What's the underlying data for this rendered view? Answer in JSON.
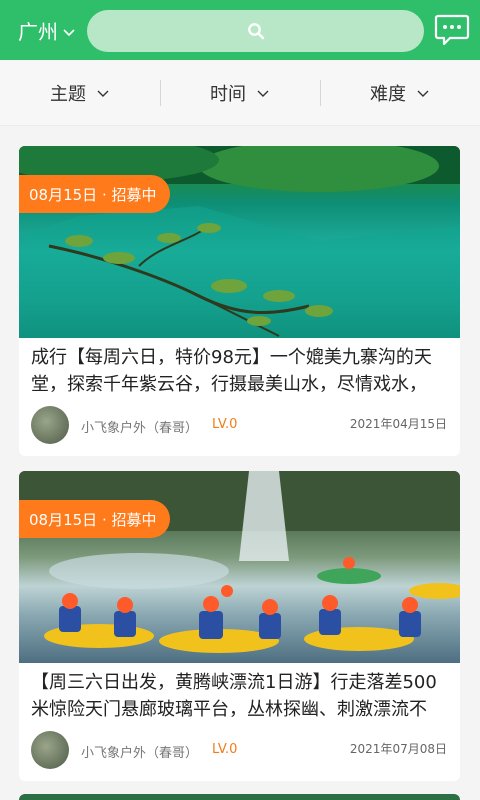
{
  "header": {
    "city": "广州",
    "search_placeholder": "",
    "icons": {
      "city_dropdown": "chevron-down-icon",
      "search": "search-icon",
      "message": "chat-bubble-icon"
    },
    "brand_color": "#2fbf6b"
  },
  "filters": [
    {
      "label": "主题"
    },
    {
      "label": "时间"
    },
    {
      "label": "难度"
    }
  ],
  "cards": [
    {
      "badge": "08月15日 · 招募中",
      "title": "成行【每周六日，特价98元】一个媲美九寨沟的天堂，探索千年紫云谷，行摄最美山水，尽情戏水，",
      "author": "小飞象户外（春哥）",
      "level": "LV.0",
      "date": "2021年04月15日"
    },
    {
      "badge": "08月15日 · 招募中",
      "title": "【周三六日出发，黄腾峡漂流1日游】行走落差500米惊险天门悬廊玻璃平台，丛林探幽、刺激漂流不",
      "author": "小飞象户外（春哥）",
      "level": "LV.0",
      "date": "2021年07月08日"
    }
  ],
  "colors": {
    "badge": "#ff7a1a",
    "level": "#f07c1a"
  }
}
